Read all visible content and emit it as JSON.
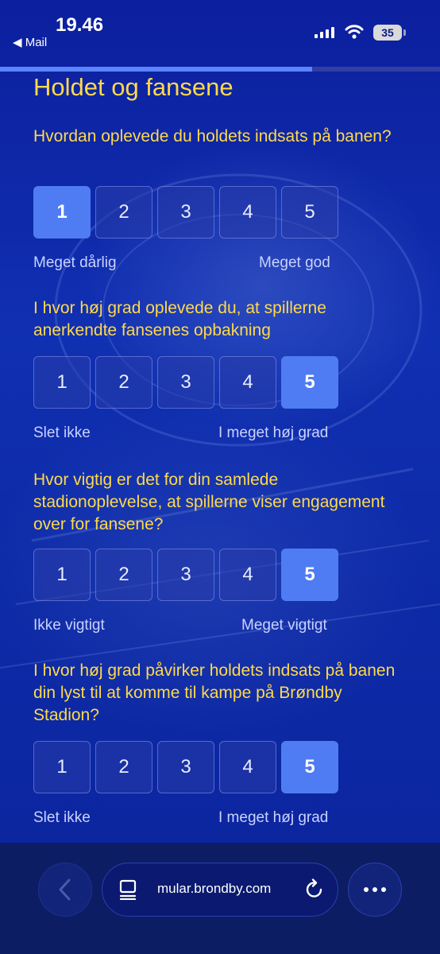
{
  "status": {
    "time": "19.46",
    "back_app": "Mail",
    "battery": "35"
  },
  "progress": {
    "fraction": 0.71
  },
  "section_title": "Holdet og fansene",
  "questions": [
    {
      "text": "Hvordan oplevede du holdets indsats på banen?",
      "options": [
        "1",
        "2",
        "3",
        "4",
        "5"
      ],
      "selected": "1",
      "low_label": "Meget dårlig",
      "high_label": "Meget god"
    },
    {
      "text": "I hvor høj grad oplevede du, at spillerne anerkendte fansenes opbakning",
      "options": [
        "1",
        "2",
        "3",
        "4",
        "5"
      ],
      "selected": "5",
      "low_label": "Slet ikke",
      "high_label": "I meget høj grad"
    },
    {
      "text": "Hvor vigtig er det for din samlede stadionoplevelse, at spillerne viser engagement over for fansene?",
      "options": [
        "1",
        "2",
        "3",
        "4",
        "5"
      ],
      "selected": "5",
      "low_label": "Ikke vigtigt",
      "high_label": "Meget vigtigt"
    },
    {
      "text": "I hvor høj grad påvirker holdets indsats på banen din lyst til at komme til kampe på Brøndby Stadion?",
      "options": [
        "1",
        "2",
        "3",
        "4",
        "5"
      ],
      "selected": "5",
      "low_label": "Slet ikke",
      "high_label": "I meget høj grad"
    }
  ],
  "browser": {
    "url": "mular.brondby.com"
  },
  "colors": {
    "accent_yellow": "#ffd94a",
    "selected_blue": "#4f7cf2",
    "background": "#0c1f9e"
  }
}
